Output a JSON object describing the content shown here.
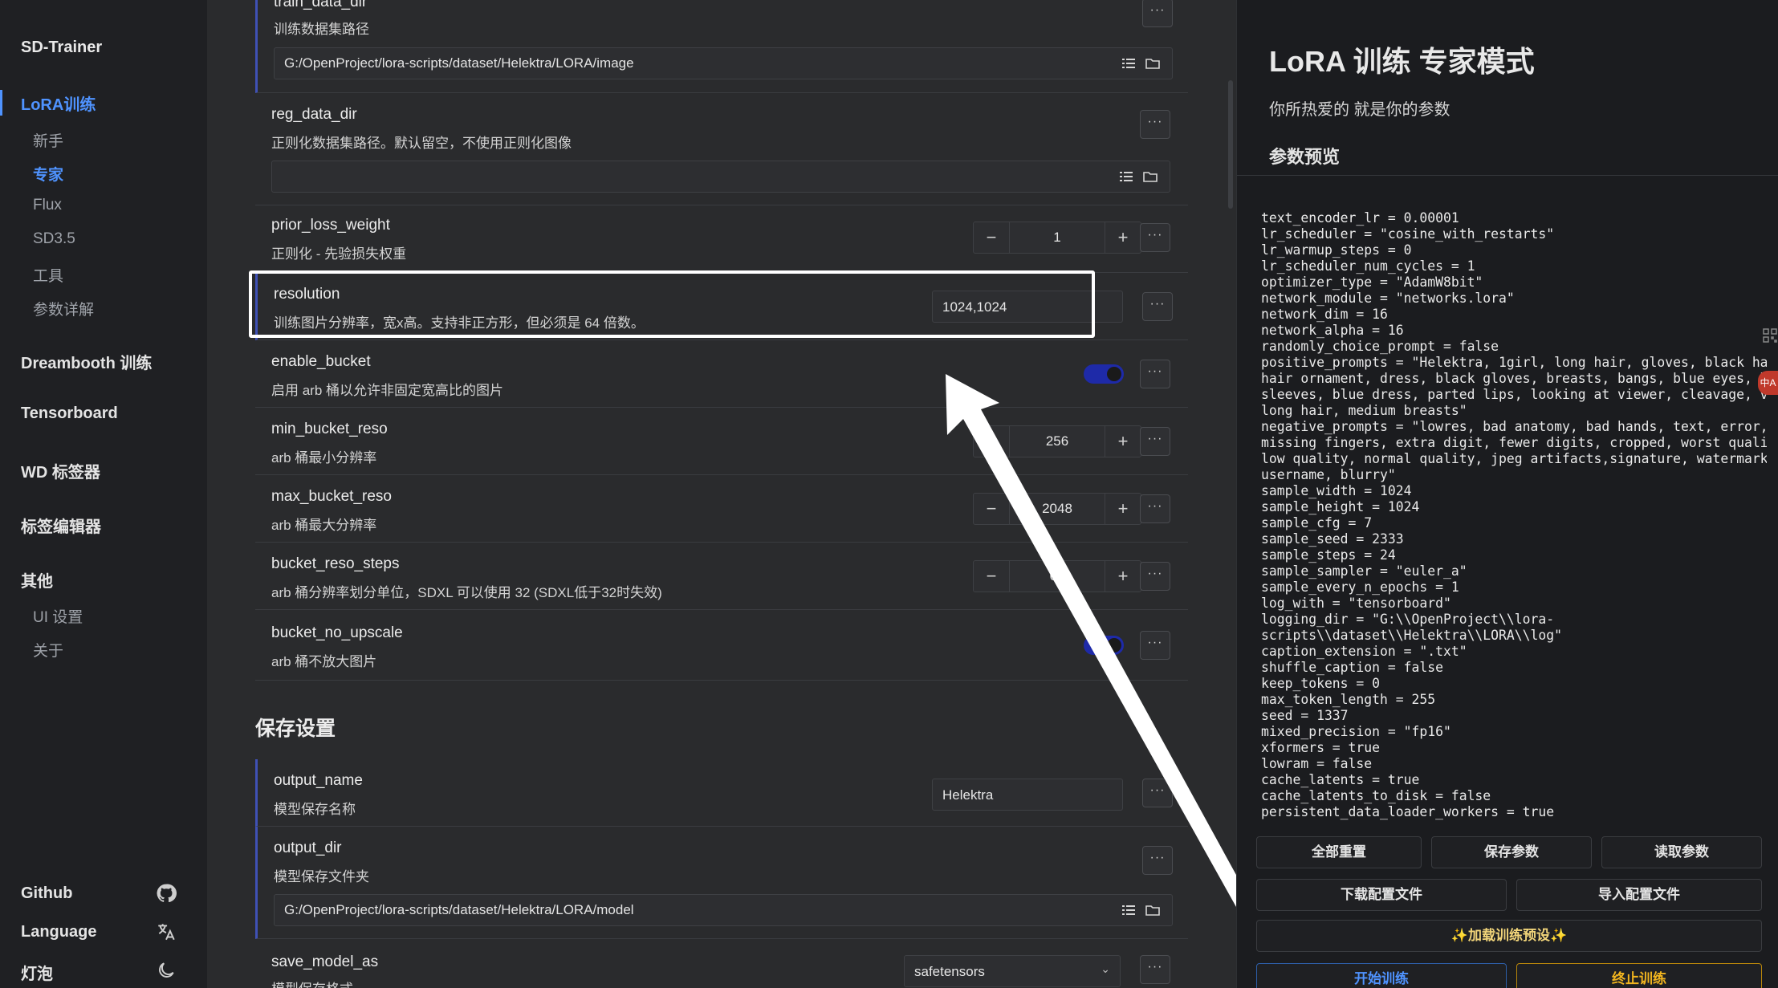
{
  "sidebar": {
    "brand": "SD-Trainer",
    "lora_label": "LoRA训练",
    "sub_items": [
      "新手",
      "专家",
      "Flux",
      "SD3.5",
      "工具",
      "参数详解"
    ],
    "dreambooth": "Dreambooth 训练",
    "tensorboard": "Tensorboard",
    "wd_tagger": "WD 标签器",
    "tag_editor": "标签编辑器",
    "other": "其他",
    "other_items": [
      "UI 设置",
      "关于"
    ],
    "github": "Github",
    "language": "Language",
    "theme": "灯泡"
  },
  "settings": {
    "train_data_dir": {
      "name": "train_data_dir",
      "desc": "训练数据集路径",
      "value": "G:/OpenProject/lora-scripts/dataset/Helektra/LORA/image"
    },
    "reg_data_dir": {
      "name": "reg_data_dir",
      "desc": "正则化数据集路径。默认留空，不使用正则化图像",
      "value": ""
    },
    "prior_loss_weight": {
      "name": "prior_loss_weight",
      "desc": "正则化 - 先验损失权重",
      "value": "1"
    },
    "resolution": {
      "name": "resolution",
      "desc": "训练图片分辨率，宽x高。支持非正方形，但必须是 64 倍数。",
      "value": "1024,1024"
    },
    "enable_bucket": {
      "name": "enable_bucket",
      "desc": "启用 arb 桶以允许非固定宽高比的图片",
      "on": true
    },
    "min_bucket_reso": {
      "name": "min_bucket_reso",
      "desc": "arb 桶最小分辨率",
      "value": "256"
    },
    "max_bucket_reso": {
      "name": "max_bucket_reso",
      "desc": "arb 桶最大分辨率",
      "value": "2048"
    },
    "bucket_reso_steps": {
      "name": "bucket_reso_steps",
      "desc": "arb 桶分辨率划分单位，SDXL 可以使用 32 (SDXL低于32时失效)",
      "value": "64"
    },
    "bucket_no_upscale": {
      "name": "bucket_no_upscale",
      "desc": "arb 桶不放大图片",
      "on": true
    }
  },
  "save_section_title": "保存设置",
  "save": {
    "output_name": {
      "name": "output_name",
      "desc": "模型保存名称",
      "value": "Helektra"
    },
    "output_dir": {
      "name": "output_dir",
      "desc": "模型保存文件夹",
      "value": "G:/OpenProject/lora-scripts/dataset/Helektra/LORA/model"
    },
    "save_model_as": {
      "name": "save_model_as",
      "desc": "模型保存格式",
      "value": "safetensors"
    }
  },
  "more_label": "···",
  "panel": {
    "title": "LoRA 训练 专家模式",
    "subtitle": "你所热爱的 就是你的参数",
    "preview_title": "参数预览",
    "preview_lines": [
      "text_encoder_lr = 0.00001",
      "lr_scheduler = \"cosine_with_restarts\"",
      "lr_warmup_steps = 0",
      "lr_scheduler_num_cycles = 1",
      "optimizer_type = \"AdamW8bit\"",
      "network_module = \"networks.lora\"",
      "network_dim = 16",
      "network_alpha = 16",
      "randomly_choice_prompt = false",
      "positive_prompts = \"Helektra, 1girl, long hair, gloves, black hair,",
      "hair ornament, dress, black gloves, breasts, bangs, blue eyes, long",
      "sleeves, blue dress, parted lips, looking at viewer, cleavage, very",
      "long hair, medium breasts\"",
      "negative_prompts = \"lowres, bad anatomy, bad hands, text, error,",
      "missing fingers, extra digit, fewer digits, cropped, worst quality,",
      "low quality, normal quality, jpeg artifacts,signature, watermark,",
      "username, blurry\"",
      "sample_width = 1024",
      "sample_height = 1024",
      "sample_cfg = 7",
      "sample_seed = 2333",
      "sample_steps = 24",
      "sample_sampler = \"euler_a\"",
      "sample_every_n_epochs = 1",
      "log_with = \"tensorboard\"",
      "logging_dir = \"G:\\\\OpenProject\\\\lora-",
      "scripts\\\\dataset\\\\Helektra\\\\LORA\\\\log\"",
      "caption_extension = \".txt\"",
      "shuffle_caption = false",
      "keep_tokens = 0",
      "max_token_length = 255",
      "seed = 1337",
      "mixed_precision = \"fp16\"",
      "xformers = true",
      "lowram = false",
      "cache_latents = true",
      "cache_latents_to_disk = false",
      "persistent_data_loader_workers = true"
    ],
    "btn_reset": "全部重置",
    "btn_save": "保存参数",
    "btn_load": "读取参数",
    "btn_download": "下载配置文件",
    "btn_import": "导入配置文件",
    "btn_preset": "✨加载训练预设✨",
    "btn_start": "开始训练",
    "btn_stop": "终止训练",
    "side_badge": "中A"
  }
}
